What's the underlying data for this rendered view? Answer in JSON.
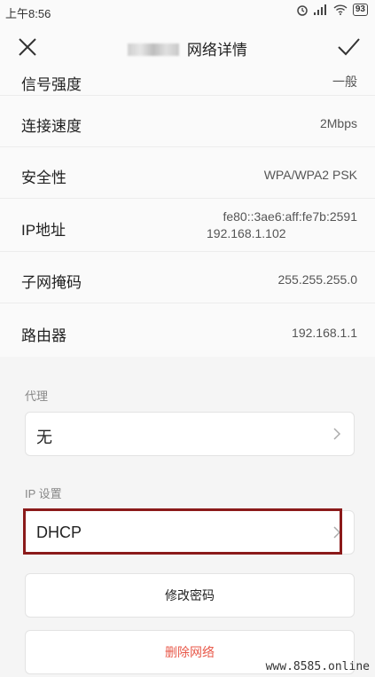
{
  "status_bar": {
    "time": "上午8:56",
    "battery": "93"
  },
  "header": {
    "title": "网络详情"
  },
  "details": [
    {
      "label": "信号强度",
      "value": "一般"
    },
    {
      "label": "连接速度",
      "value": "2Mbps"
    },
    {
      "label": "安全性",
      "value": "WPA/WPA2 PSK"
    },
    {
      "label": "IP地址",
      "value_line1": "fe80::3ae6:aff:fe7b:2591",
      "value_line2": "192.168.1.102"
    },
    {
      "label": "子网掩码",
      "value": "255.255.255.0"
    },
    {
      "label": "路由器",
      "value": "192.168.1.1"
    }
  ],
  "proxy": {
    "section_label": "代理",
    "value": "无"
  },
  "ip_settings": {
    "section_label": "IP 设置",
    "value": "DHCP"
  },
  "buttons": {
    "change_password": "修改密码",
    "delete_network": "删除网络"
  },
  "colors": {
    "danger": "#e8594a",
    "highlight_box": "#8b1a1a"
  },
  "watermark": "www.8585.online"
}
